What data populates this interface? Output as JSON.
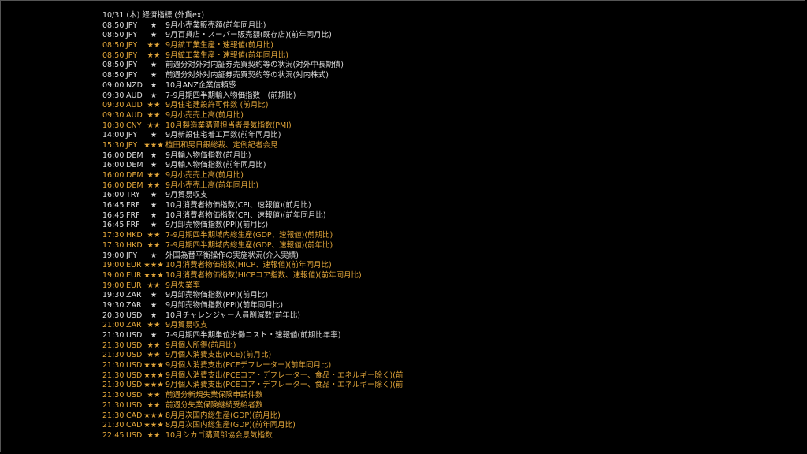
{
  "title": "10/31 (木) 経済指標 (外貨ex)",
  "events": [
    {
      "time": "08:50",
      "currency": "JPY",
      "stars": "★",
      "indicator": "9月小売業販売額(前年同月比)",
      "highlight": false
    },
    {
      "time": "08:50",
      "currency": "JPY",
      "stars": "★",
      "indicator": "9月百貨店・スーパー販売額(既存店)(前年同月比)",
      "highlight": false
    },
    {
      "time": "08:50",
      "currency": "JPY",
      "stars": "★★",
      "indicator": "9月鉱工業生産・速報値(前月比)",
      "highlight": true
    },
    {
      "time": "08:50",
      "currency": "JPY",
      "stars": "★★",
      "indicator": "9月鉱工業生産・速報値(前年同月比)",
      "highlight": true
    },
    {
      "time": "08:50",
      "currency": "JPY",
      "stars": "★",
      "indicator": "前週分対外対内証券売買契約等の状況(対外中長期債)",
      "highlight": false
    },
    {
      "time": "08:50",
      "currency": "JPY",
      "stars": "★",
      "indicator": "前週分対外対内証券売買契約等の状況(対内株式)",
      "highlight": false
    },
    {
      "time": "09:00",
      "currency": "NZD",
      "stars": "★",
      "indicator": "10月ANZ企業信頼感",
      "highlight": false
    },
    {
      "time": "09:30",
      "currency": "AUD",
      "stars": "★",
      "indicator": "7-9月期四半期輸入物価指数　(前期比)",
      "highlight": false
    },
    {
      "time": "09:30",
      "currency": "AUD",
      "stars": "★★",
      "indicator": "9月住宅建設許可件数 (前月比)",
      "highlight": true
    },
    {
      "time": "09:30",
      "currency": "AUD",
      "stars": "★★",
      "indicator": "9月小売売上高(前月比)",
      "highlight": true
    },
    {
      "time": "10:30",
      "currency": "CNY",
      "stars": "★★",
      "indicator": "10月製造業購買担当者景気指数(PMI)",
      "highlight": true
    },
    {
      "time": "14:00",
      "currency": "JPY",
      "stars": "★",
      "indicator": "9月新設住宅着工戸数(前年同月比)",
      "highlight": false
    },
    {
      "time": "15:30",
      "currency": "JPY",
      "stars": "★★★",
      "indicator": "植田和男日銀総裁、定例記者会見",
      "highlight": true
    },
    {
      "time": "16:00",
      "currency": "DEM",
      "stars": "★",
      "indicator": "9月輸入物価指数(前月比)",
      "highlight": false
    },
    {
      "time": "16:00",
      "currency": "DEM",
      "stars": "★",
      "indicator": "9月輸入物価指数(前年同月比)",
      "highlight": false
    },
    {
      "time": "16:00",
      "currency": "DEM",
      "stars": "★★",
      "indicator": "9月小売売上高(前月比)",
      "highlight": true
    },
    {
      "time": "16:00",
      "currency": "DEM",
      "stars": "★★",
      "indicator": "9月小売売上高(前年同月比)",
      "highlight": true
    },
    {
      "time": "16:00",
      "currency": "TRY",
      "stars": "★",
      "indicator": "9月貿易収支",
      "highlight": false
    },
    {
      "time": "16:45",
      "currency": "FRF",
      "stars": "★",
      "indicator": "10月消費者物価指数(CPI、速報値)(前月比)",
      "highlight": false
    },
    {
      "time": "16:45",
      "currency": "FRF",
      "stars": "★",
      "indicator": "10月消費者物価指数(CPI、速報値)(前年同月比)",
      "highlight": false
    },
    {
      "time": "16:45",
      "currency": "FRF",
      "stars": "★",
      "indicator": "9月卸売物価指数(PPI)(前月比)",
      "highlight": false
    },
    {
      "time": "17:30",
      "currency": "HKD",
      "stars": "★★",
      "indicator": "7-9月期四半期域内総生産(GDP、速報値)(前期比)",
      "highlight": true
    },
    {
      "time": "17:30",
      "currency": "HKD",
      "stars": "★★",
      "indicator": "7-9月期四半期域内総生産(GDP、速報値)(前年比)",
      "highlight": true
    },
    {
      "time": "19:00",
      "currency": "JPY",
      "stars": "★",
      "indicator": "外国為替平衡操作の実施状況(介入実績)",
      "highlight": false
    },
    {
      "time": "19:00",
      "currency": "EUR",
      "stars": "★★★",
      "indicator": "10月消費者物価指数(HICP、速報値)(前年同月比)",
      "highlight": true
    },
    {
      "time": "19:00",
      "currency": "EUR",
      "stars": "★★★",
      "indicator": "10月消費者物価指数(HICPコア指数、速報値)(前年同月比)",
      "highlight": true
    },
    {
      "time": "19:00",
      "currency": "EUR",
      "stars": "★★",
      "indicator": "9月失業率",
      "highlight": true
    },
    {
      "time": "19:30",
      "currency": "ZAR",
      "stars": "★",
      "indicator": "9月卸売物価指数(PPI)(前月比)",
      "highlight": false
    },
    {
      "time": "19:30",
      "currency": "ZAR",
      "stars": "★",
      "indicator": "9月卸売物価指数(PPI)(前年同月比)",
      "highlight": false
    },
    {
      "time": "20:30",
      "currency": "USD",
      "stars": "★",
      "indicator": "10月チャレンジャー人員削減数(前年比)",
      "highlight": false
    },
    {
      "time": "21:00",
      "currency": "ZAR",
      "stars": "★★",
      "indicator": "9月貿易収支",
      "highlight": true
    },
    {
      "time": "21:30",
      "currency": "USD",
      "stars": "★",
      "indicator": "7-9月期四半期単位労働コスト・速報値(前期比年率)",
      "highlight": false
    },
    {
      "time": "21:30",
      "currency": "USD",
      "stars": "★★",
      "indicator": "9月個人所得(前月比)",
      "highlight": true
    },
    {
      "time": "21:30",
      "currency": "USD",
      "stars": "★★",
      "indicator": "9月個人消費支出(PCE)(前月比)",
      "highlight": true
    },
    {
      "time": "21:30",
      "currency": "USD",
      "stars": "★★★",
      "indicator": "9月個人消費支出(PCEデフレーター)(前年同月比)",
      "highlight": true
    },
    {
      "time": "21:30",
      "currency": "USD",
      "stars": "★★★",
      "indicator": "9月個人消費支出(PCEコア・デフレーター、食品・エネルギー除く)(前",
      "highlight": true
    },
    {
      "time": "21:30",
      "currency": "USD",
      "stars": "★★★",
      "indicator": "9月個人消費支出(PCEコア・デフレーター、食品・エネルギー除く)(前",
      "highlight": true
    },
    {
      "time": "21:30",
      "currency": "USD",
      "stars": "★★",
      "indicator": "前週分新規失業保険申請件数",
      "highlight": true
    },
    {
      "time": "21:30",
      "currency": "USD",
      "stars": "★★",
      "indicator": "前週分失業保険継続受給者数",
      "highlight": true
    },
    {
      "time": "21:30",
      "currency": "CAD",
      "stars": "★★★",
      "indicator": "8月月次国内総生産(GDP)(前月比)",
      "highlight": true
    },
    {
      "time": "21:30",
      "currency": "CAD",
      "stars": "★★★",
      "indicator": "8月月次国内総生産(GDP)(前年同月比)",
      "highlight": true
    },
    {
      "time": "22:45",
      "currency": "USD",
      "stars": "★★",
      "indicator": "10月シカゴ購買部協会景気指数",
      "highlight": true
    }
  ],
  "colors": {
    "text": "#dddddd",
    "highlight": "#e2a63a",
    "background": "#000000"
  }
}
